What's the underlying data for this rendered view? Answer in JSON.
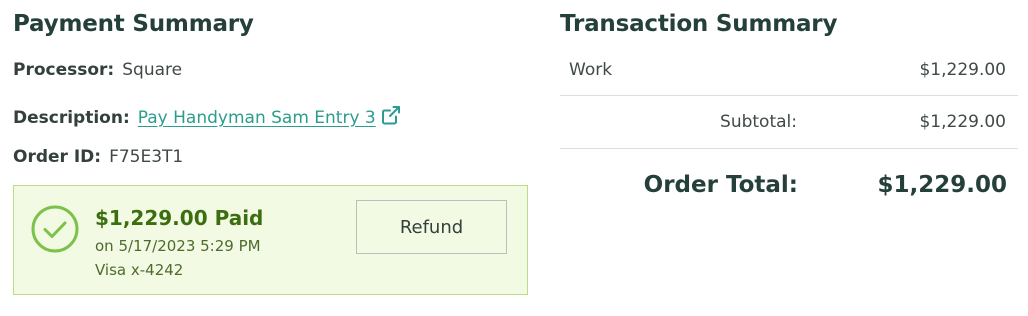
{
  "payment_summary": {
    "title": "Payment Summary",
    "processor_label": "Processor:",
    "processor_value": "Square",
    "description_label": "Description:",
    "description_link": "Pay Handyman Sam Entry 3",
    "external_icon": "external-link-icon",
    "order_id_label": "Order ID:",
    "order_id_value": "F75E3T1",
    "paid_box": {
      "status_icon": "check-circle-icon",
      "amount_status": "$1,229.00 Paid",
      "date": "on 5/17/2023 5:29 PM",
      "card": "Visa x-4242",
      "refund_label": "Refund"
    }
  },
  "transaction_summary": {
    "title": "Transaction Summary",
    "line_items": [
      {
        "label": "Work",
        "amount": "$1,229.00"
      }
    ],
    "subtotal_label": "Subtotal:",
    "subtotal_amount": "$1,229.00",
    "order_total_label": "Order Total:",
    "order_total_amount": "$1,229.00"
  },
  "colors": {
    "heading": "#25403a",
    "link": "#2a9d8f",
    "paid_bg": "#f2fae3",
    "paid_border": "#b9dd8a",
    "paid_text": "#3c6e10",
    "check_icon": "#7cc14a"
  }
}
